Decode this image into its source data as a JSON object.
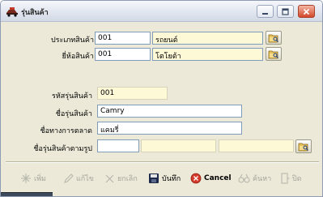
{
  "window": {
    "title": "รุ่นสินค้า"
  },
  "form": {
    "category": {
      "label": "ประเภทสินค้า",
      "code": "001",
      "name": "รถยนต์"
    },
    "brand": {
      "label": "ยี่ห้อสินค้า",
      "code": "001",
      "name": "โตโยต้า"
    },
    "model_code": {
      "label": "รหัสรุ่นสินค้า",
      "value": "001"
    },
    "model_name": {
      "label": "ชื่อรุ่นสินค้า",
      "value": "Camry"
    },
    "market_name": {
      "label": "ชื่อทางการตลาด",
      "value": "แคมรี่"
    },
    "model_by_image": {
      "label": "ชื่อรุ่นสินค้าตามรูป",
      "value1": "",
      "value2": "",
      "value3": ""
    }
  },
  "toolbar": {
    "add": "เพิ่ม",
    "edit": "แก้ไข",
    "delete": "ยกเลิก",
    "save": "บันทึก",
    "cancel": "Cancel",
    "search": "ค้นหา",
    "close": "ปิด"
  },
  "colors": {
    "window_bg": "#ece9d8",
    "readonly_field": "#fdf9d7",
    "field_border": "#7f9db9"
  }
}
